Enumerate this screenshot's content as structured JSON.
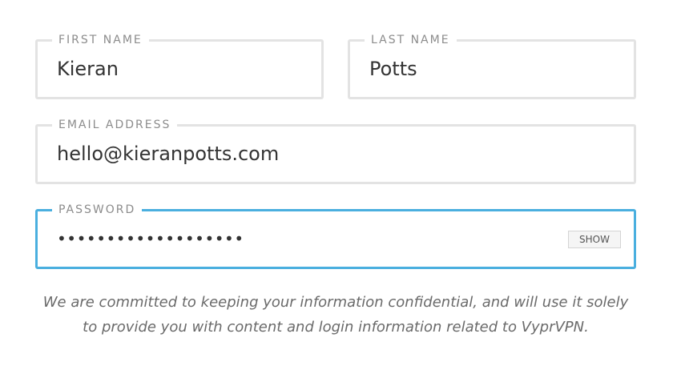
{
  "form": {
    "first_name": {
      "label": "FIRST NAME",
      "value": "Kieran"
    },
    "last_name": {
      "label": "LAST NAME",
      "value": "Potts"
    },
    "email": {
      "label": "EMAIL ADDRESS",
      "value": "hello@kieranpotts.com"
    },
    "password": {
      "label": "PASSWORD",
      "masked_value": "•••••••••••••••••••",
      "show_label": "SHOW"
    },
    "disclaimer": "We are committed to keeping your information confidential, and will use it solely to provide you with content and login information related to VyprVPN."
  },
  "colors": {
    "field_border": "#e3e3e3",
    "focus_border": "#4aafdf",
    "label_text": "#8c8c8c",
    "value_text": "#333333"
  }
}
